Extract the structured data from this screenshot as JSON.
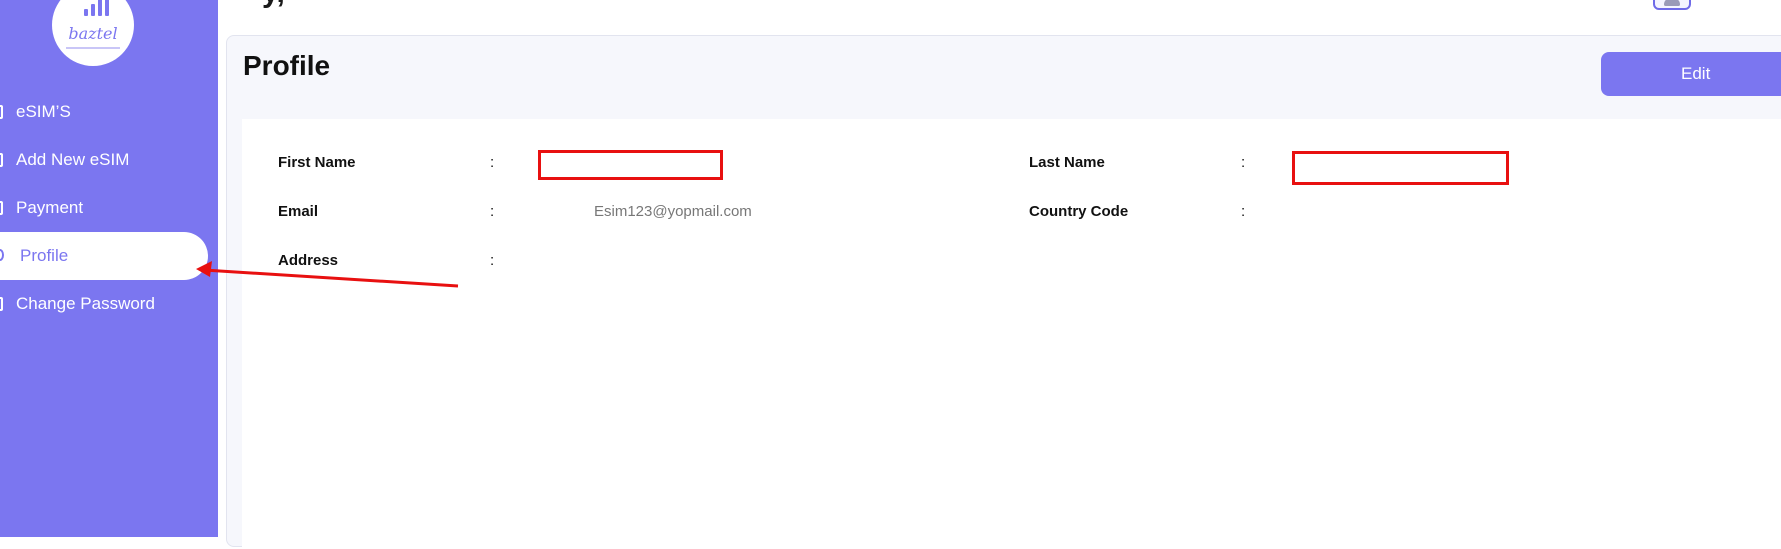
{
  "sidebar": {
    "logo": {
      "brand": "baztel"
    },
    "items": [
      {
        "label": "eSIM’S",
        "active": false
      },
      {
        "label": "Add New eSIM",
        "active": false
      },
      {
        "label": "Payment",
        "active": false
      },
      {
        "label": "Profile",
        "active": true
      },
      {
        "label": "Change Password",
        "active": false
      }
    ]
  },
  "header": {
    "greeting_fragment": "y,"
  },
  "profile": {
    "title": "Profile",
    "edit_label": "Edit",
    "separator": ":",
    "fields": {
      "first_name": {
        "label": "First Name",
        "value": ""
      },
      "last_name": {
        "label": "Last Name",
        "value": ""
      },
      "email": {
        "label": "Email",
        "value": "Esim123@yopmail.com"
      },
      "country_code": {
        "label": "Country Code",
        "value": ""
      },
      "address": {
        "label": "Address",
        "value": ""
      }
    }
  },
  "colors": {
    "accent": "#7b76f0",
    "annotation": "#e81010",
    "card_background": "#f6f7fc"
  }
}
